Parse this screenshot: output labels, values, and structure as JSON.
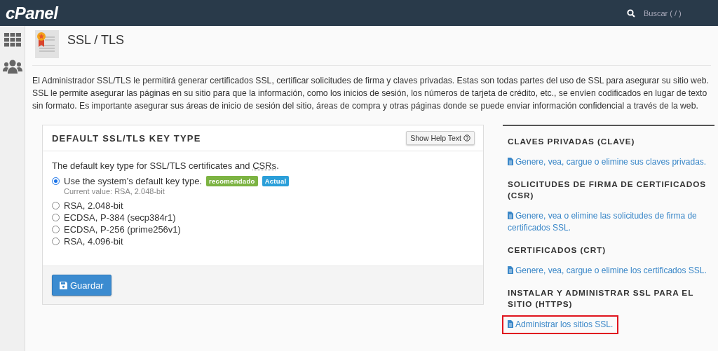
{
  "topbar": {
    "logo": "cPanel",
    "search_placeholder": "Buscar ( / )"
  },
  "page": {
    "title": "SSL / TLS",
    "description": "El Administrador SSL/TLS le permitirá generar certificados SSL, certificar solicitudes de firma y claves privadas. Estas son todas partes del uso de SSL para asegurar su sitio web. SSL le permite asegurar las páginas en su sitio para que la información, como los inicios de sesión, los números de tarjeta de crédito, etc., se envíen codificados en lugar de texto sin formato. Es importante asegurar sus áreas de inicio de sesión del sitio, áreas de compra y otras páginas donde se puede enviar información confidencial a través de la web."
  },
  "key_panel": {
    "title": "DEFAULT SSL/TLS KEY TYPE",
    "help_button": "Show Help Text",
    "intro": "The default key type for SSL/TLS certificates and",
    "intro_abbr": "CSRs",
    "intro_end": ".",
    "options": [
      {
        "label": "Use the system’s default key type.",
        "selected": true,
        "badges": [
          {
            "text": "recomendado",
            "color": "#7cb342"
          },
          {
            "text": "Actual",
            "color": "#2b9fd9"
          }
        ],
        "note": "Current value: RSA, 2.048-bit"
      },
      {
        "label": "RSA, 2.048-bit",
        "selected": false
      },
      {
        "label": "ECDSA, P-384 (secp384r1)",
        "selected": false
      },
      {
        "label": "ECDSA, P-256 (prime256v1)",
        "selected": false
      },
      {
        "label": "RSA, 4.096-bit",
        "selected": false
      }
    ],
    "save_button": "Guardar"
  },
  "sections": [
    {
      "heading": "CLAVES PRIVADAS (CLAVE)",
      "link": "Genere, vea, cargue o elimine sus claves privadas.",
      "highlighted": false
    },
    {
      "heading": "SOLICITUDES DE FIRMA DE CERTIFICADOS (CSR)",
      "link": "Genere, vea o elimine las solicitudes de firma de certificados SSL.",
      "highlighted": false
    },
    {
      "heading": "CERTIFICADOS (CRT)",
      "link": "Genere, vea, cargue o elimine los certificados SSL.",
      "highlighted": false
    },
    {
      "heading": "INSTALAR Y ADMINISTRAR SSL PARA EL SITIO (HTTPS)",
      "link": "Administrar los sitios SSL.",
      "highlighted": true
    }
  ]
}
